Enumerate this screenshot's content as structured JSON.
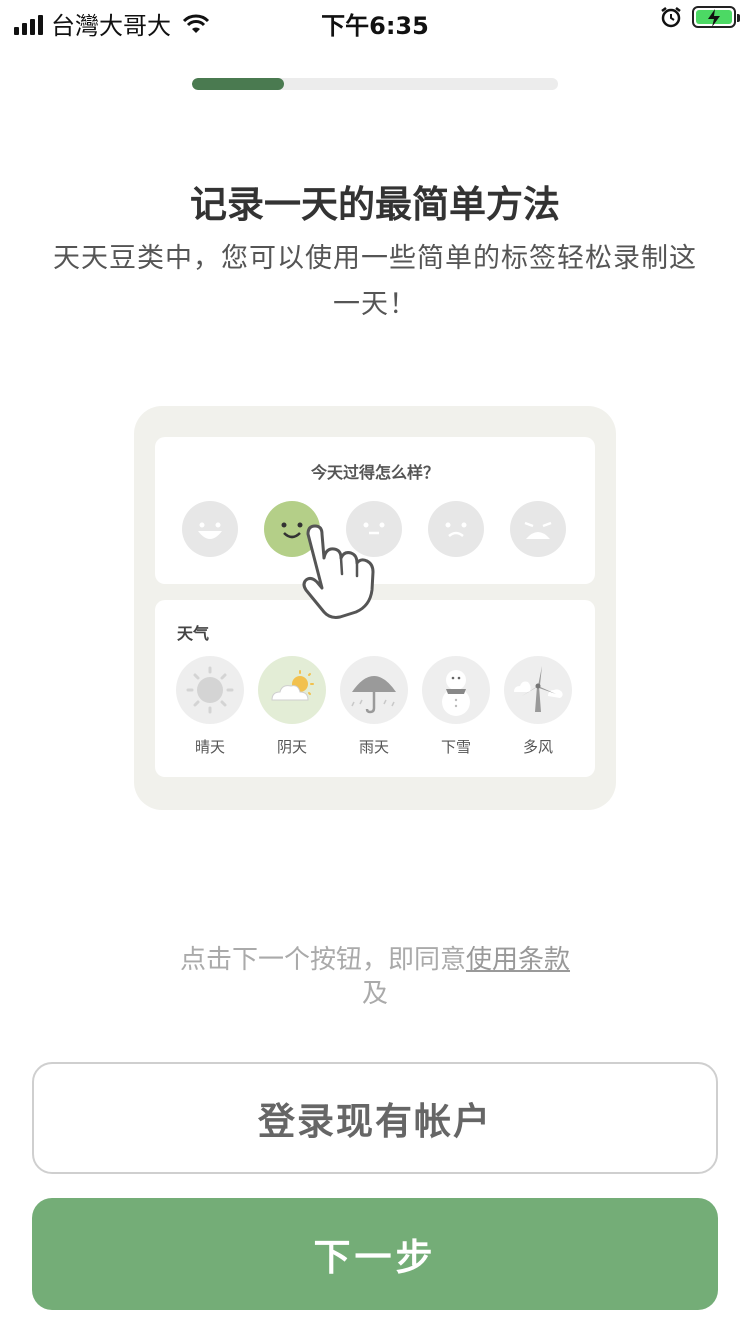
{
  "status_bar": {
    "carrier": "台灣大哥大",
    "time": "下午6:35",
    "battery_color": "#4cd964"
  },
  "progress": {
    "value": 0.25,
    "color": "#4a7a50"
  },
  "intro": {
    "title": "记录一天的最简单方法",
    "subtitle": "天天豆类中，您可以使用一些简单的标签轻松录制这一天！"
  },
  "illustration": {
    "mood_question": "今天过得怎么样？",
    "moods": [
      {
        "icon": "laugh-face-icon",
        "selected": false
      },
      {
        "icon": "smile-face-icon",
        "selected": true
      },
      {
        "icon": "neutral-face-icon",
        "selected": false
      },
      {
        "icon": "sad-face-icon",
        "selected": false
      },
      {
        "icon": "cry-face-icon",
        "selected": false
      }
    ],
    "weather_label": "天气",
    "weather": [
      {
        "label": "晴天",
        "icon": "sun-icon",
        "selected": false
      },
      {
        "label": "阴天",
        "icon": "cloudy-icon",
        "selected": true
      },
      {
        "label": "雨天",
        "icon": "umbrella-icon",
        "selected": false
      },
      {
        "label": "下雪",
        "icon": "snowman-icon",
        "selected": false
      },
      {
        "label": "多风",
        "icon": "windmill-icon",
        "selected": false
      }
    ]
  },
  "terms": {
    "prefix": "点击下一个按钮，即同意",
    "link": "使用条款",
    "suffix": "及"
  },
  "buttons": {
    "login": "登录现有帐户",
    "next": "下一步"
  },
  "colors": {
    "accent": "#74ad77",
    "selected_mood": "#b4cf88",
    "selected_weather": "#e3edd6"
  }
}
